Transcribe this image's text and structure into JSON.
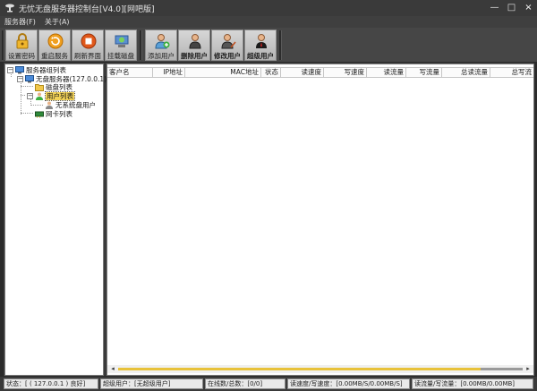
{
  "window": {
    "title": "无忧无盘服务器控制台[V4.0][网吧版]",
    "buttons": [
      "—",
      "□",
      "×"
    ]
  },
  "menu": [
    "服务器(F)",
    "关于(A)"
  ],
  "toolbar": {
    "group1": [
      {
        "label": "设置密码",
        "icon": "lock-icon"
      },
      {
        "label": "重启服务",
        "icon": "restart-icon"
      },
      {
        "label": "刷新界面",
        "icon": "refresh-icon"
      },
      {
        "label": "挂载磁盘",
        "icon": "disk-icon"
      }
    ],
    "group2": [
      {
        "label": "添加用户",
        "icon": "add-user-icon"
      },
      {
        "label": "删除用户",
        "icon": "delete-user-icon"
      },
      {
        "label": "修改用户",
        "icon": "edit-user-icon"
      },
      {
        "label": "超级用户",
        "icon": "super-user-icon"
      }
    ]
  },
  "tree": {
    "root": "服务器组列表",
    "server": "无盘服务器(127.0.0.1)",
    "disk_list": "磁盘列表",
    "user_list": "用户列表",
    "no_system_user": "无系统盘用户",
    "nic_list": "网卡列表"
  },
  "table": {
    "columns": [
      "客户名",
      "IP地址",
      "MAC地址",
      "状态",
      "读速度",
      "写速度",
      "读流量",
      "写流量",
      "总读流量",
      "总写流"
    ]
  },
  "status": {
    "state": "状态：[ ( 127.0.0.1 ) 良好]",
    "super_user": "超级用户：[无超级用户]",
    "online": "在线数/总数：[0/0]",
    "speed": "读速度/写速度：[0.00MB/S/0.00MB/S]",
    "traffic": "读流量/写流量：[0.00MB/0.00MB]"
  },
  "colors": {
    "selection": "#f3d256",
    "scroll_thumb": "#e8c23a",
    "toolbar_bg": "#464646"
  }
}
